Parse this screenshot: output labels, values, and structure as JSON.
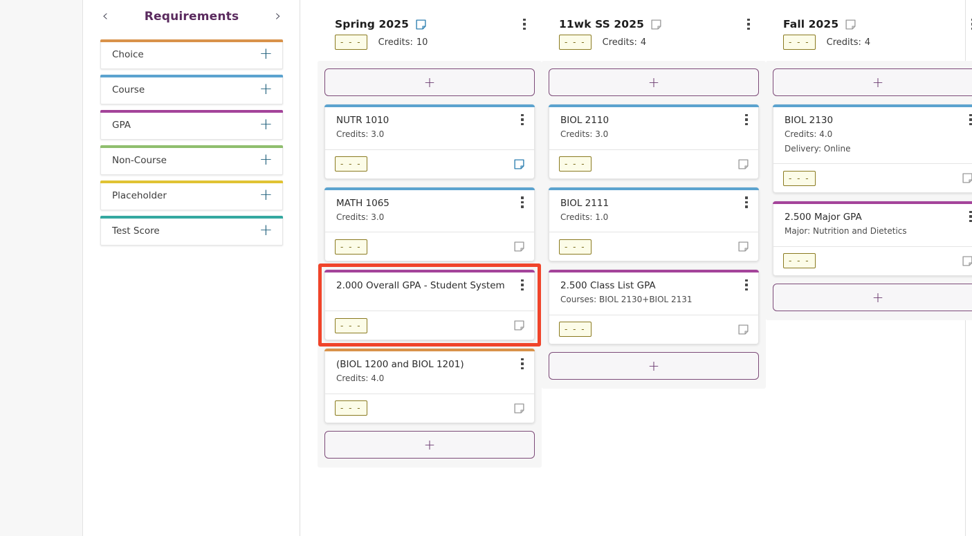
{
  "sidebar": {
    "title": "Requirements",
    "prev_icon": "chevron-left-icon",
    "next_icon": "chevron-right-icon",
    "add_label": "+",
    "items": [
      {
        "label": "Choice",
        "color": "#d9924a"
      },
      {
        "label": "Course",
        "color": "#5ba3cf"
      },
      {
        "label": "GPA",
        "color": "#a4449a"
      },
      {
        "label": "Non-Course",
        "color": "#8fbe6e"
      },
      {
        "label": "Placeholder",
        "color": "#e0c334"
      },
      {
        "label": "Test Score",
        "color": "#34a8a0"
      }
    ]
  },
  "board": {
    "add_label": "+",
    "credits_label": "Credits:",
    "state_badge": "- - -",
    "columns": [
      {
        "title": "Spring 2025",
        "note_icon": "note-icon",
        "note_active": true,
        "state_badge": "- - -",
        "credits_label": "Credits:",
        "credits": "10",
        "cards": [
          {
            "title": "NUTR 1010",
            "sub": "Credits: 3.0",
            "sub2": "",
            "color": "#5ba3cf",
            "badge": "- - -",
            "note_active": true
          },
          {
            "title": "MATH 1065",
            "sub": "Credits: 3.0",
            "sub2": "",
            "color": "#5ba3cf",
            "badge": "- - -",
            "note_active": false
          },
          {
            "title": "2.000 Overall GPA - Student System",
            "sub": "",
            "sub2": "",
            "color": "#a4449a",
            "badge": "- - -",
            "note_active": false,
            "selected": true
          },
          {
            "title": "(BIOL 1200 and BIOL 1201)",
            "sub": "Credits: 4.0",
            "sub2": "",
            "color": "#d9924a",
            "badge": "- - -",
            "note_active": false
          }
        ]
      },
      {
        "title": "11wk SS 2025",
        "note_icon": "note-icon",
        "note_active": false,
        "state_badge": "- - -",
        "credits_label": "Credits:",
        "credits": "4",
        "cards": [
          {
            "title": "BIOL 2110",
            "sub": "Credits: 3.0",
            "sub2": "",
            "color": "#5ba3cf",
            "badge": "- - -",
            "note_active": false
          },
          {
            "title": "BIOL 2111",
            "sub": "Credits: 1.0",
            "sub2": "",
            "color": "#5ba3cf",
            "badge": "- - -",
            "note_active": false
          },
          {
            "title": "2.500 Class List GPA",
            "sub": "Courses: BIOL 2130+BIOL 2131",
            "sub2": "",
            "color": "#a4449a",
            "badge": "- - -",
            "note_active": false
          }
        ]
      },
      {
        "title": "Fall 2025",
        "note_icon": "note-icon",
        "note_active": false,
        "state_badge": "- - -",
        "credits_label": "Credits:",
        "credits": "4",
        "cards": [
          {
            "title": "BIOL 2130",
            "sub": "Credits: 4.0",
            "sub2": "Delivery: Online",
            "color": "#5ba3cf",
            "badge": "- - -",
            "note_active": false
          },
          {
            "title": "2.500 Major GPA",
            "sub": "Major: Nutrition and Dietetics",
            "sub2": "",
            "color": "#a4449a",
            "badge": "- - -",
            "note_active": false
          }
        ]
      }
    ]
  },
  "selection": {
    "color": "#f0442a"
  }
}
